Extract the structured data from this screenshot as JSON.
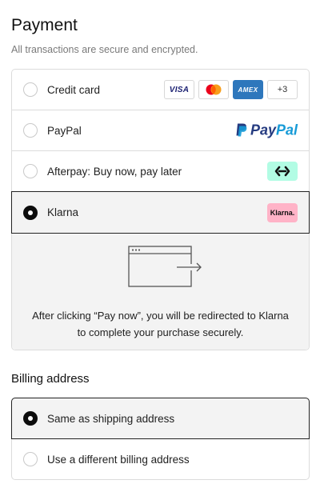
{
  "payment": {
    "title": "Payment",
    "subtitle": "All transactions are secure and encrypted.",
    "options": [
      {
        "label": "Credit card",
        "selected": false,
        "logos": [
          "VISA",
          "mastercard-icon",
          "AMEX",
          "+3"
        ]
      },
      {
        "label": "PayPal",
        "selected": false,
        "logo_text_pay": "Pay",
        "logo_text_pal": "Pal"
      },
      {
        "label": "Afterpay: Buy now, pay later",
        "selected": false,
        "logo": "afterpay-icon"
      },
      {
        "label": "Klarna",
        "selected": true,
        "logo_text": "Klarna."
      }
    ],
    "klarna_message": "After clicking “Pay now”, you will be redirected to Klarna to complete your purchase securely."
  },
  "billing": {
    "title": "Billing address",
    "options": [
      {
        "label": "Same as shipping address",
        "selected": true
      },
      {
        "label": "Use a different billing address",
        "selected": false
      }
    ]
  },
  "colors": {
    "selected_radio": "#0c0c0c",
    "selected_bg": "#f3f3f3",
    "border": "#dcdcdc",
    "amex_blue": "#2e77bc",
    "afterpay_mint": "#b2fce4",
    "klarna_pink": "#ffb3c7",
    "paypal_dark": "#253b80",
    "paypal_light": "#179bd7"
  }
}
